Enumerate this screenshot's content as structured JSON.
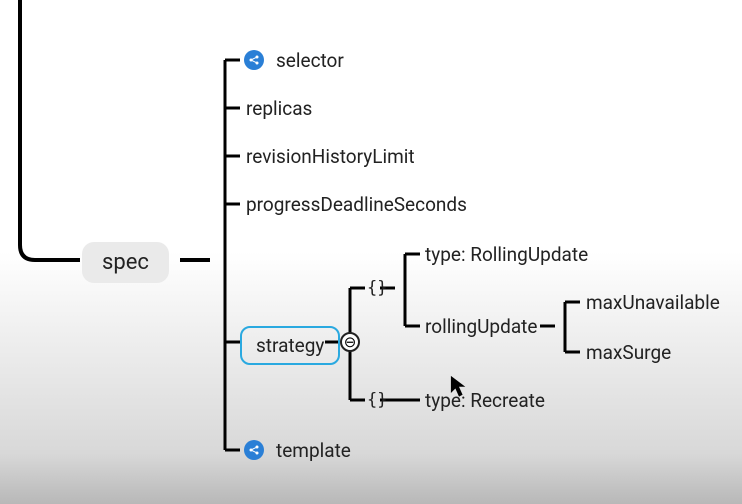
{
  "root": {
    "label": "spec"
  },
  "children": {
    "selector": {
      "label": "selector",
      "hasShare": true
    },
    "replicas": {
      "label": "replicas"
    },
    "revisionHistoryLimit": {
      "label": "revisionHistoryLimit"
    },
    "progressDeadlineSeconds": {
      "label": "progressDeadlineSeconds"
    },
    "strategy": {
      "label": "strategy",
      "selected": true
    },
    "template": {
      "label": "template",
      "hasShare": true
    }
  },
  "strategy": {
    "option1": {
      "bracket": "{}",
      "type": {
        "label": "type: RollingUpdate"
      },
      "rollingUpdate": {
        "label": "rollingUpdate",
        "children": {
          "maxUnavailable": {
            "label": "maxUnavailable"
          },
          "maxSurge": {
            "label": "maxSurge"
          }
        }
      }
    },
    "option2": {
      "bracket": "{}",
      "type": {
        "label": "type: Recreate"
      }
    },
    "oneOfGlyph": "⊖"
  },
  "icons": {
    "share": "share-icon",
    "oneOf": "one-of-icon",
    "cursor": "cursor-icon"
  }
}
